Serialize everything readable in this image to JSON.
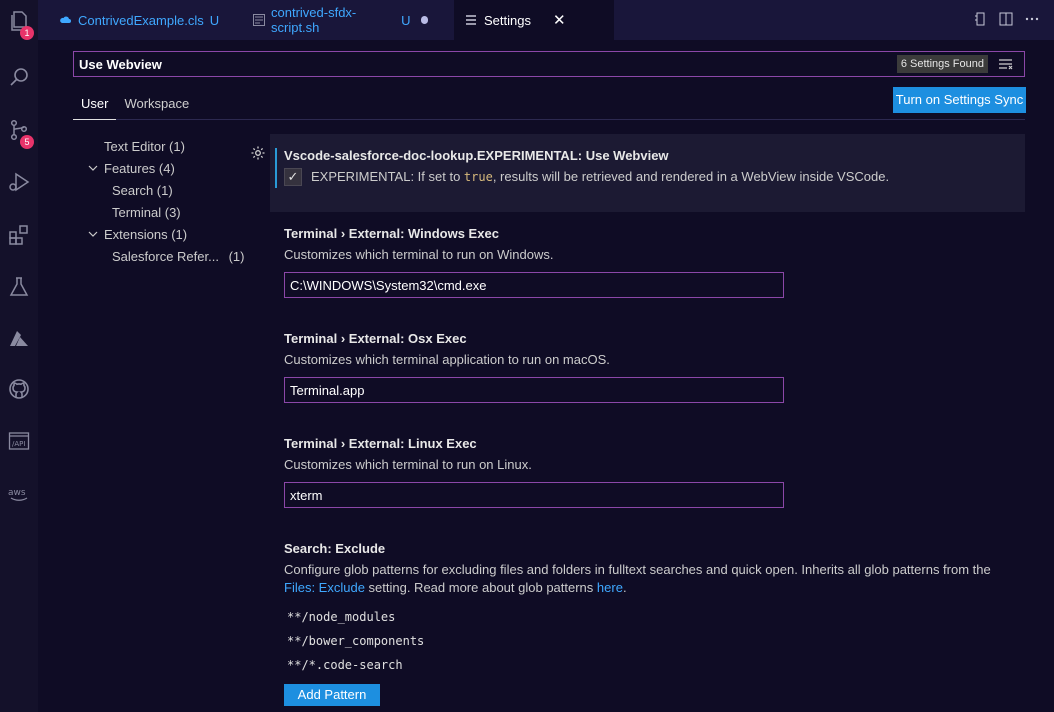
{
  "activity_bar": {
    "items": [
      {
        "icon": "files-icon",
        "badge": "1"
      },
      {
        "icon": "search-icon",
        "badge": ""
      },
      {
        "icon": "source-control-icon",
        "badge": "5"
      },
      {
        "icon": "run-debug-icon",
        "badge": ""
      },
      {
        "icon": "extensions-icon",
        "badge": ""
      },
      {
        "icon": "testing-flask-icon",
        "badge": ""
      },
      {
        "icon": "azure-icon",
        "badge": ""
      },
      {
        "icon": "github-icon",
        "badge": ""
      },
      {
        "icon": "api-icon",
        "badge": ""
      },
      {
        "icon": "aws-icon",
        "badge": ""
      }
    ]
  },
  "tabs": [
    {
      "label": "ContrivedExample.cls",
      "status": "U"
    },
    {
      "label": "contrived-sfdx-script.sh",
      "status": "U"
    },
    {
      "label": "Settings",
      "close": "✕"
    }
  ],
  "search": {
    "value": "Use Webview",
    "found_label": "6 Settings Found"
  },
  "scope_tabs": {
    "user": "User",
    "workspace": "Workspace"
  },
  "sync_button": "Turn on Settings Sync",
  "toc": [
    {
      "label": "Text Editor (1)",
      "chev": ""
    },
    {
      "label": "Features (4)",
      "chev": "⌄"
    },
    {
      "label": "Search (1)",
      "chev": ""
    },
    {
      "label": "Terminal (3)",
      "chev": ""
    },
    {
      "label": "Extensions (1)",
      "chev": "⌄"
    },
    {
      "label": "Salesforce Refer...",
      "count": "(1)",
      "chev": ""
    }
  ],
  "settings": {
    "webview": {
      "title": "Vscode-salesforce-doc-lookup.EXPERIMENTAL: Use Webview",
      "desc_pre": "EXPERIMENTAL: If set to ",
      "desc_code": "true",
      "desc_post": ", results will be retrieved and rendered in a WebView inside VSCode.",
      "checked": "✓"
    },
    "windows": {
      "title": "Terminal › External: Windows Exec",
      "desc": "Customizes which terminal to run on Windows.",
      "value": "C:\\WINDOWS\\System32\\cmd.exe"
    },
    "osx": {
      "title": "Terminal › External: Osx Exec",
      "desc": "Customizes which terminal application to run on macOS.",
      "value": "Terminal.app"
    },
    "linux": {
      "title": "Terminal › External: Linux Exec",
      "desc": "Customizes which terminal to run on Linux.",
      "value": "xterm"
    },
    "search_exclude": {
      "title": "Search: Exclude",
      "desc1": "Configure glob patterns for excluding files and folders in fulltext searches and quick open. Inherits all glob patterns from the",
      "desc2_link": "Files: Exclude",
      "desc2_mid": " setting. Read more about glob patterns ",
      "desc2_link2": "here",
      "desc2_end": ".",
      "patterns": [
        "**/node_modules",
        "**/bower_components",
        "**/*.code-search"
      ],
      "add_button": "Add Pattern"
    }
  }
}
